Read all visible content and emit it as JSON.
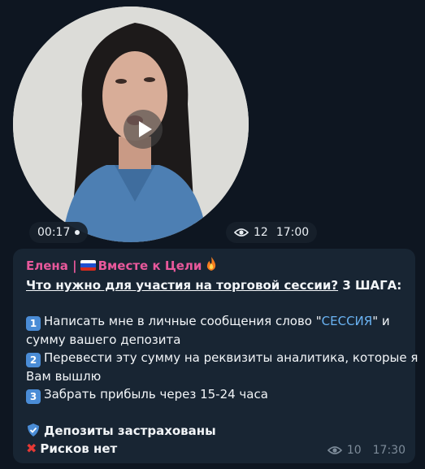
{
  "video": {
    "duration": "00:17",
    "views": "12",
    "time": "17:00"
  },
  "message": {
    "author": "Елена | ",
    "author_suffix": "Вместе к Цели",
    "question": "Что нужно для участия на торговой сессии?",
    "steps_title": " 3 ШАГА:",
    "step1_num": "1",
    "step1_text_a": "Написать мне в личные сообщения слово \"",
    "step1_keyword": "СЕССИЯ",
    "step1_text_b": "\" и",
    "step1_text_c": "сумму вашего депозита",
    "step2_num": "2",
    "step2_text_a": "Перевести эту сумму на реквизиты аналитика, которые я",
    "step2_text_b": "Вам вышлю",
    "step3_num": "3",
    "step3_text": "Забрать прибыль через 15-24 часа",
    "line_deposits": "Депозиты застрахованы",
    "line_risks": "Рисков нет",
    "views": "10",
    "time": "17:30"
  },
  "icons": {
    "eye": "eye-icon",
    "play": "play-icon",
    "fire": "fire-icon",
    "flag": "russia-flag-icon",
    "shield": "shield-icon",
    "cross": "cross-mark-icon"
  },
  "colors": {
    "background": "#0e1621",
    "bubble": "#182533",
    "author": "#e8589b",
    "link": "#6ab3f3",
    "meta": "#7d8b99"
  }
}
